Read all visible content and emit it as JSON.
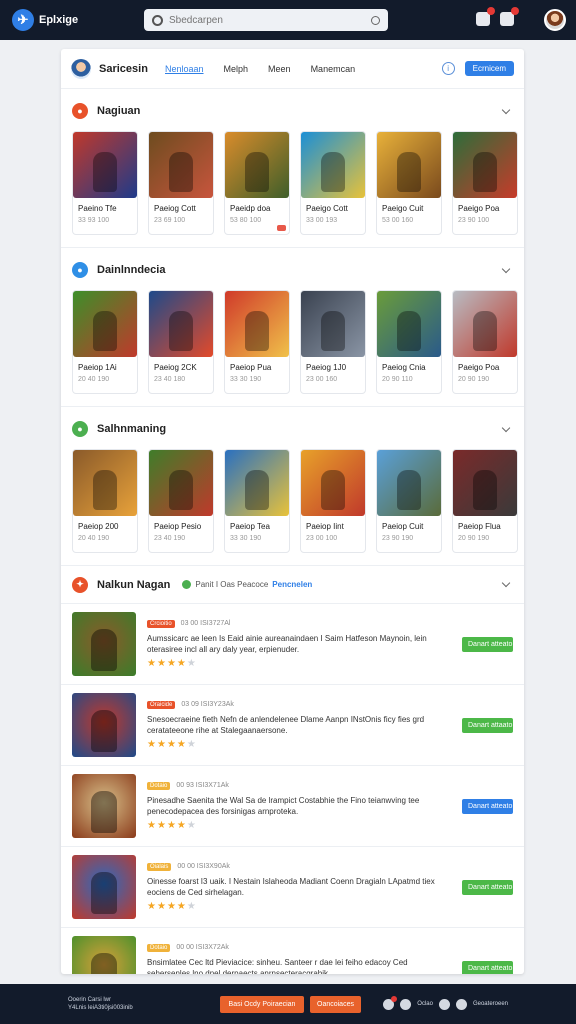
{
  "header": {
    "brand": "Eplxige",
    "search_placeholder": "Sbedcarpen",
    "notifications": 2
  },
  "nav": {
    "title": "Saricesin",
    "tabs": [
      "Nenloaan",
      "Melph",
      "Meen",
      "Manemcan"
    ],
    "active_tab": 0,
    "button": "Ecrnicem"
  },
  "sections": [
    {
      "title": "Nagiuan",
      "icon_color": "#e8522a",
      "icon": "fire-icon",
      "cards": [
        {
          "title": "Paeino Tfe",
          "meta": "33  93  100",
          "c1": "#c0392b",
          "c2": "#1e3a8a"
        },
        {
          "title": "Paeiog Cott",
          "meta": "23  69  100",
          "c1": "#6d4c1f",
          "c2": "#c8553d"
        },
        {
          "title": "Paeidp doa",
          "meta": "53  80  100",
          "c1": "#d98c2b",
          "c2": "#3e5e2a"
        },
        {
          "title": "Paeigo Cott",
          "meta": "33  00  193",
          "c1": "#1b8fd6",
          "c2": "#e7c23a"
        },
        {
          "title": "Paeigo Cuit",
          "meta": "53  00  160",
          "c1": "#e8b13a",
          "c2": "#7a4a1d"
        },
        {
          "title": "Paeigo Poa",
          "meta": "23  90  100",
          "c1": "#2d6d3a",
          "c2": "#c73b2a"
        }
      ]
    },
    {
      "title": "Dainlnndecia",
      "icon_color": "#2f8fe6",
      "icon": "music-icon",
      "cards": [
        {
          "title": "Paeiop 1Ai",
          "meta": "20  40  190",
          "c1": "#3d8f2a",
          "c2": "#c0392b"
        },
        {
          "title": "Paeiog 2CK",
          "meta": "23  40  180",
          "c1": "#1e4a8a",
          "c2": "#e34a2a"
        },
        {
          "title": "Paeiop Pua",
          "meta": "33  30  190",
          "c1": "#d03a2a",
          "c2": "#f0c14a"
        },
        {
          "title": "Paeiog 1J0",
          "meta": "23  00  160",
          "c1": "#3a4250",
          "c2": "#8a95a5"
        },
        {
          "title": "Paeiog Cnia",
          "meta": "20  90  110",
          "c1": "#6a9c3a",
          "c2": "#2a5a8a"
        },
        {
          "title": "Paeigo Poa",
          "meta": "20  90  190",
          "c1": "#b8bcc3",
          "c2": "#c0392b"
        }
      ]
    },
    {
      "title": "Salhnmaning",
      "icon_color": "#4caf50",
      "icon": "check-icon",
      "cards": [
        {
          "title": "Paeiop 200",
          "meta": "20  40  190",
          "c1": "#8a5a2a",
          "c2": "#e8a23a"
        },
        {
          "title": "Paeiop Pesio",
          "meta": "23  40  190",
          "c1": "#3f7d2a",
          "c2": "#c0392b"
        },
        {
          "title": "Paeiop Tea",
          "meta": "33  30  190",
          "c1": "#2a70c0",
          "c2": "#e8c23a"
        },
        {
          "title": "Paeiop Iint",
          "meta": "23  00  100",
          "c1": "#e8a12a",
          "c2": "#c0392b"
        },
        {
          "title": "Paeiop Cuit",
          "meta": "23  90  190",
          "c1": "#5aa0d8",
          "c2": "#5a6b3a"
        },
        {
          "title": "Paeiop Flua",
          "meta": "20  90  190",
          "c1": "#7a2a2a",
          "c2": "#3a3a3a"
        }
      ]
    }
  ],
  "list": {
    "title": "Nalkun Nagan",
    "subtitle": "Panit I Oas Peacoce",
    "subtitle_link": "Pencnelen",
    "icon_color": "#e8522a",
    "rows": [
      {
        "tag": "Crcioitio",
        "tag_color": "#e8522a",
        "meta": "03 00 ISI3727Al",
        "desc": "Aumssicarc ae leen Is Eaid ainie aureanaindaen I Saim Hatfeson Maynoin, lein oterasiree incl all ary daly year, erpienuder.",
        "stars": 4,
        "btn": "Danart atteato",
        "btn_color": "#4cb848",
        "c1": "#3a7d2a",
        "c2": "#8a5a2a"
      },
      {
        "tag": "Oraicide",
        "tag_color": "#e8522a",
        "meta": "03 09 ISI3Y23Ak",
        "desc": "Snesoecraeine fieth Nefn de anlendelenee Dlame Aanpn INstOnis ficy fies grd ceratateeone rihe at Stalegaanaersone.",
        "stars": 4,
        "btn": "Danart attaato",
        "btn_color": "#4cb848",
        "c1": "#1e4a8a",
        "c2": "#c0392b"
      },
      {
        "tag": "Dotaio",
        "tag_color": "#f0b23a",
        "meta": "00 93 ISI3X71Ak",
        "desc": "Pinesadhe Saenita the Wal Sa de lrampict Costabhie the Fino teianwving tee penecodepacea des forsinigas arnproteka.",
        "stars": 4,
        "btn": "Danart atteato",
        "btn_color": "#2f7fe6",
        "c1": "#8a3a1a",
        "c2": "#d8c08a"
      },
      {
        "tag": "Oialais",
        "tag_color": "#f0b23a",
        "meta": "00 00 ISI3X90Ak",
        "desc": "Oinesse foarst I3 uaik. I Nestain Islaheoda Madiant Coenn Dragialn LApatmd tiex eociens de Ced sirhelagan.",
        "stars": 4,
        "btn": "Danart atteato",
        "btn_color": "#4cb848",
        "c1": "#c0392b",
        "c2": "#2a6ac0"
      },
      {
        "tag": "Dotaio",
        "tag_color": "#f0b23a",
        "meta": "00 00 ISI3X72Ak",
        "desc": "Bnsimlatee Cec ltd Pieviacice: sinheu. Santeer r dae lei feiho edacoy Ced sehersenles lno dnel derpaects anrnsecteracgrabik.",
        "stars": 4,
        "btn": "Danart atteato",
        "btn_color": "#4cb848",
        "c1": "#3f8f2a",
        "c2": "#d8a03a"
      }
    ]
  },
  "footer": {
    "line1": "Ooerin Carsi lwr",
    "line2": "Y4Lnis leiA3ti0jsi003inib",
    "btn1": "Basi Ocdy Poiraecian",
    "btn2": "Oancoiaces",
    "right_label1": "Oclao",
    "right_label2": "Geoateroeen"
  }
}
